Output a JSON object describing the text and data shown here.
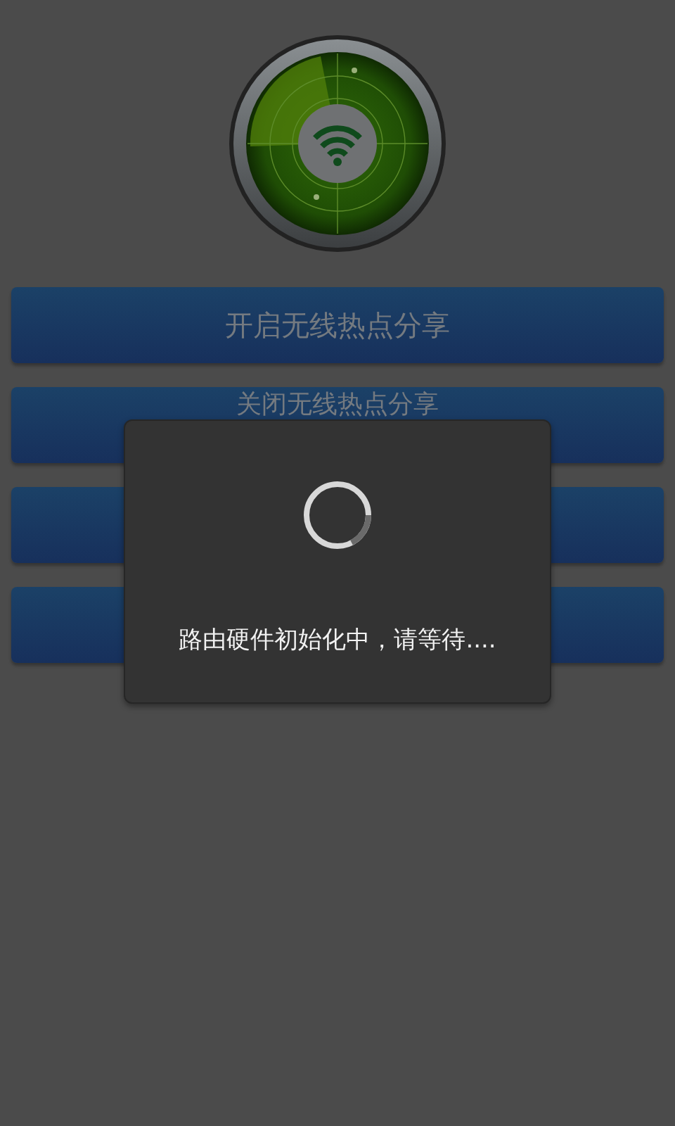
{
  "buttons": [
    {
      "kind": "labeled",
      "label": "开启无线热点分享"
    },
    {
      "kind": "labeled",
      "label": "关闭无线热点分享"
    },
    {
      "kind": "blank"
    },
    {
      "kind": "blank"
    }
  ],
  "dialog": {
    "kind": "progress",
    "message": "路由硬件初始化中，请等待...."
  }
}
